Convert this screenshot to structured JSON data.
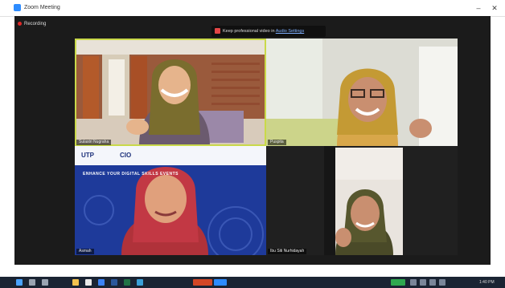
{
  "window": {
    "title": "Zoom Meeting",
    "minimize_glyph": "–",
    "close_glyph": "✕"
  },
  "recording": {
    "label": "Recording"
  },
  "banner": {
    "text": "Keep professional video in",
    "link": "Audio Settings"
  },
  "participants": [
    {
      "id": "top-left",
      "name": "Sulastri Nugraha",
      "active_speaker": true
    },
    {
      "id": "top-right",
      "name": "Puspita"
    },
    {
      "id": "bottom-left",
      "name": "Asmah"
    },
    {
      "id": "bottom-right",
      "name": "Ibu Siti Nurhidayah"
    }
  ],
  "slide": {
    "logo_left": "UTP",
    "logo_mid": "CIO",
    "headline": "ENHANCE YOUR DIGITAL SKILLS EVENTS"
  },
  "taskbar": {
    "icons": [
      "windows-icon",
      "search-icon",
      "taskview-icon",
      "explorer-icon",
      "chrome-icon",
      "edge-icon",
      "word-icon",
      "excel-icon",
      "powerpoint-icon",
      "zoom-icon",
      "photos-icon"
    ],
    "clock": "1:40 PM"
  },
  "colors": {
    "stage_bg": "#1b1b1b",
    "active_border": "#c9d94a",
    "slide_blue": "#1e3a9a",
    "taskbar_bg": "#1a2433"
  }
}
